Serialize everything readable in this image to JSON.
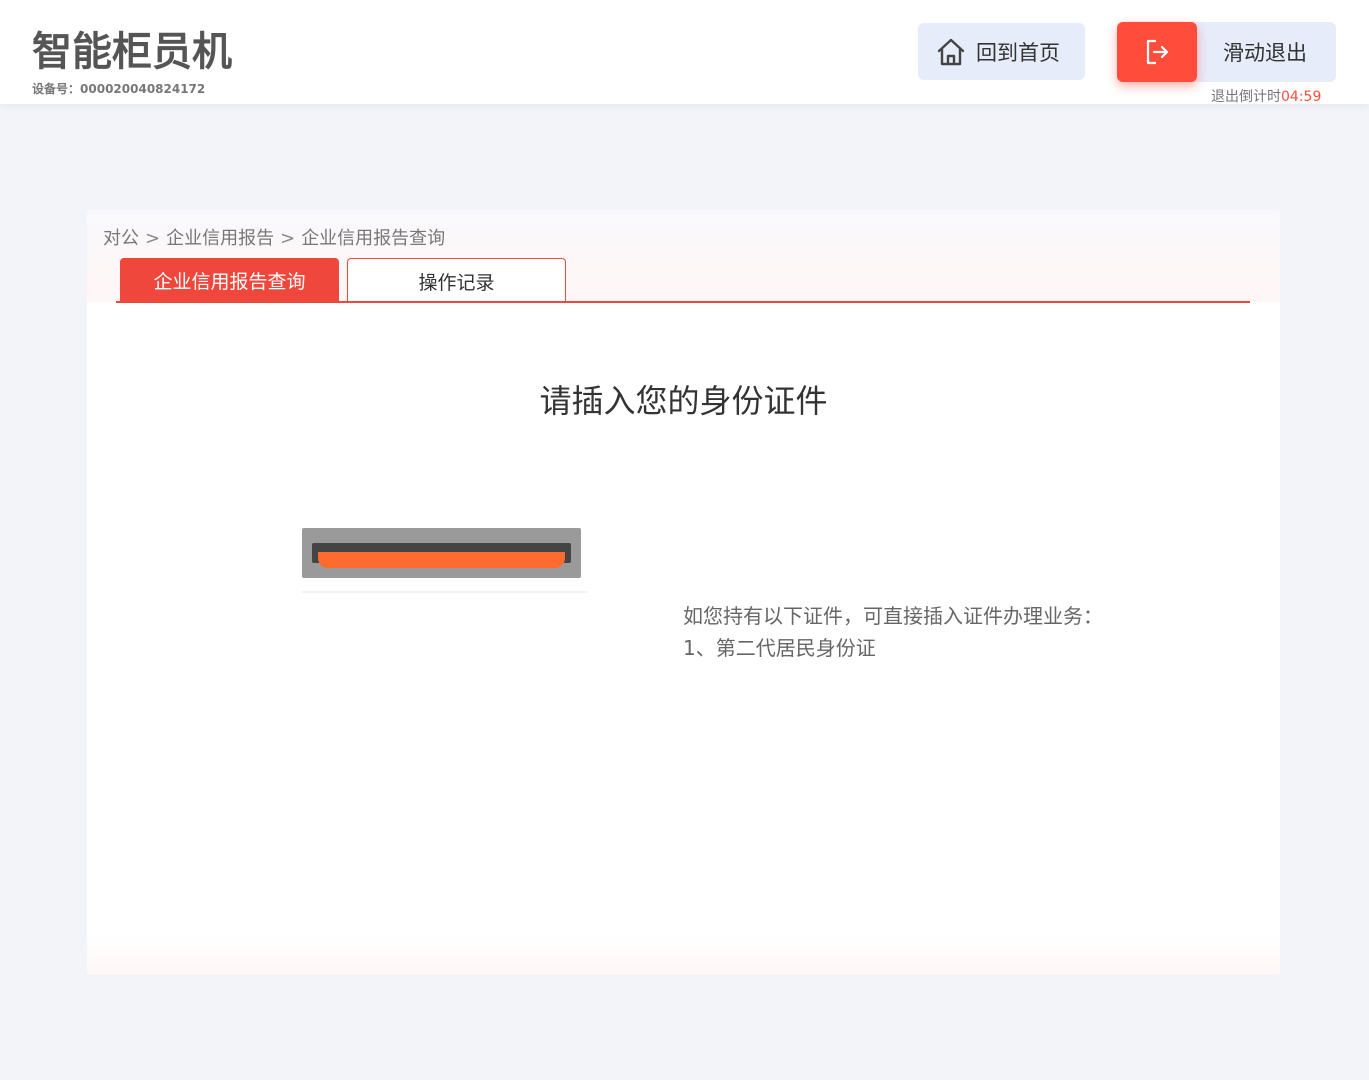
{
  "header": {
    "app_title": "智能柜员机",
    "device_label": "设备号：",
    "device_number": "000020040824172",
    "home_button": {
      "label": "回到首页",
      "icon": "home-icon"
    },
    "exit_button": {
      "label": "滑动退出",
      "icon": "exit-icon"
    },
    "countdown_label": "退出倒计时",
    "countdown_time": "04:59"
  },
  "breadcrumb": {
    "items": [
      "对公",
      "企业信用报告",
      "企业信用报告查询"
    ],
    "separator": ">"
  },
  "tabs": [
    {
      "label": "企业信用报告查询",
      "active": true
    },
    {
      "label": "操作记录",
      "active": false
    }
  ],
  "main": {
    "prompt": "请插入您的身份证件",
    "info_line1": "如您持有以下证件，可直接插入证件办理业务：",
    "info_line2": "1、第二代居民身份证"
  },
  "colors": {
    "accent": "#f0473d",
    "exit_red": "#ff4c3b",
    "button_bg": "#e6ecf9",
    "page_bg": "#f3f4fa",
    "card_slot": "#ff6a2e"
  }
}
